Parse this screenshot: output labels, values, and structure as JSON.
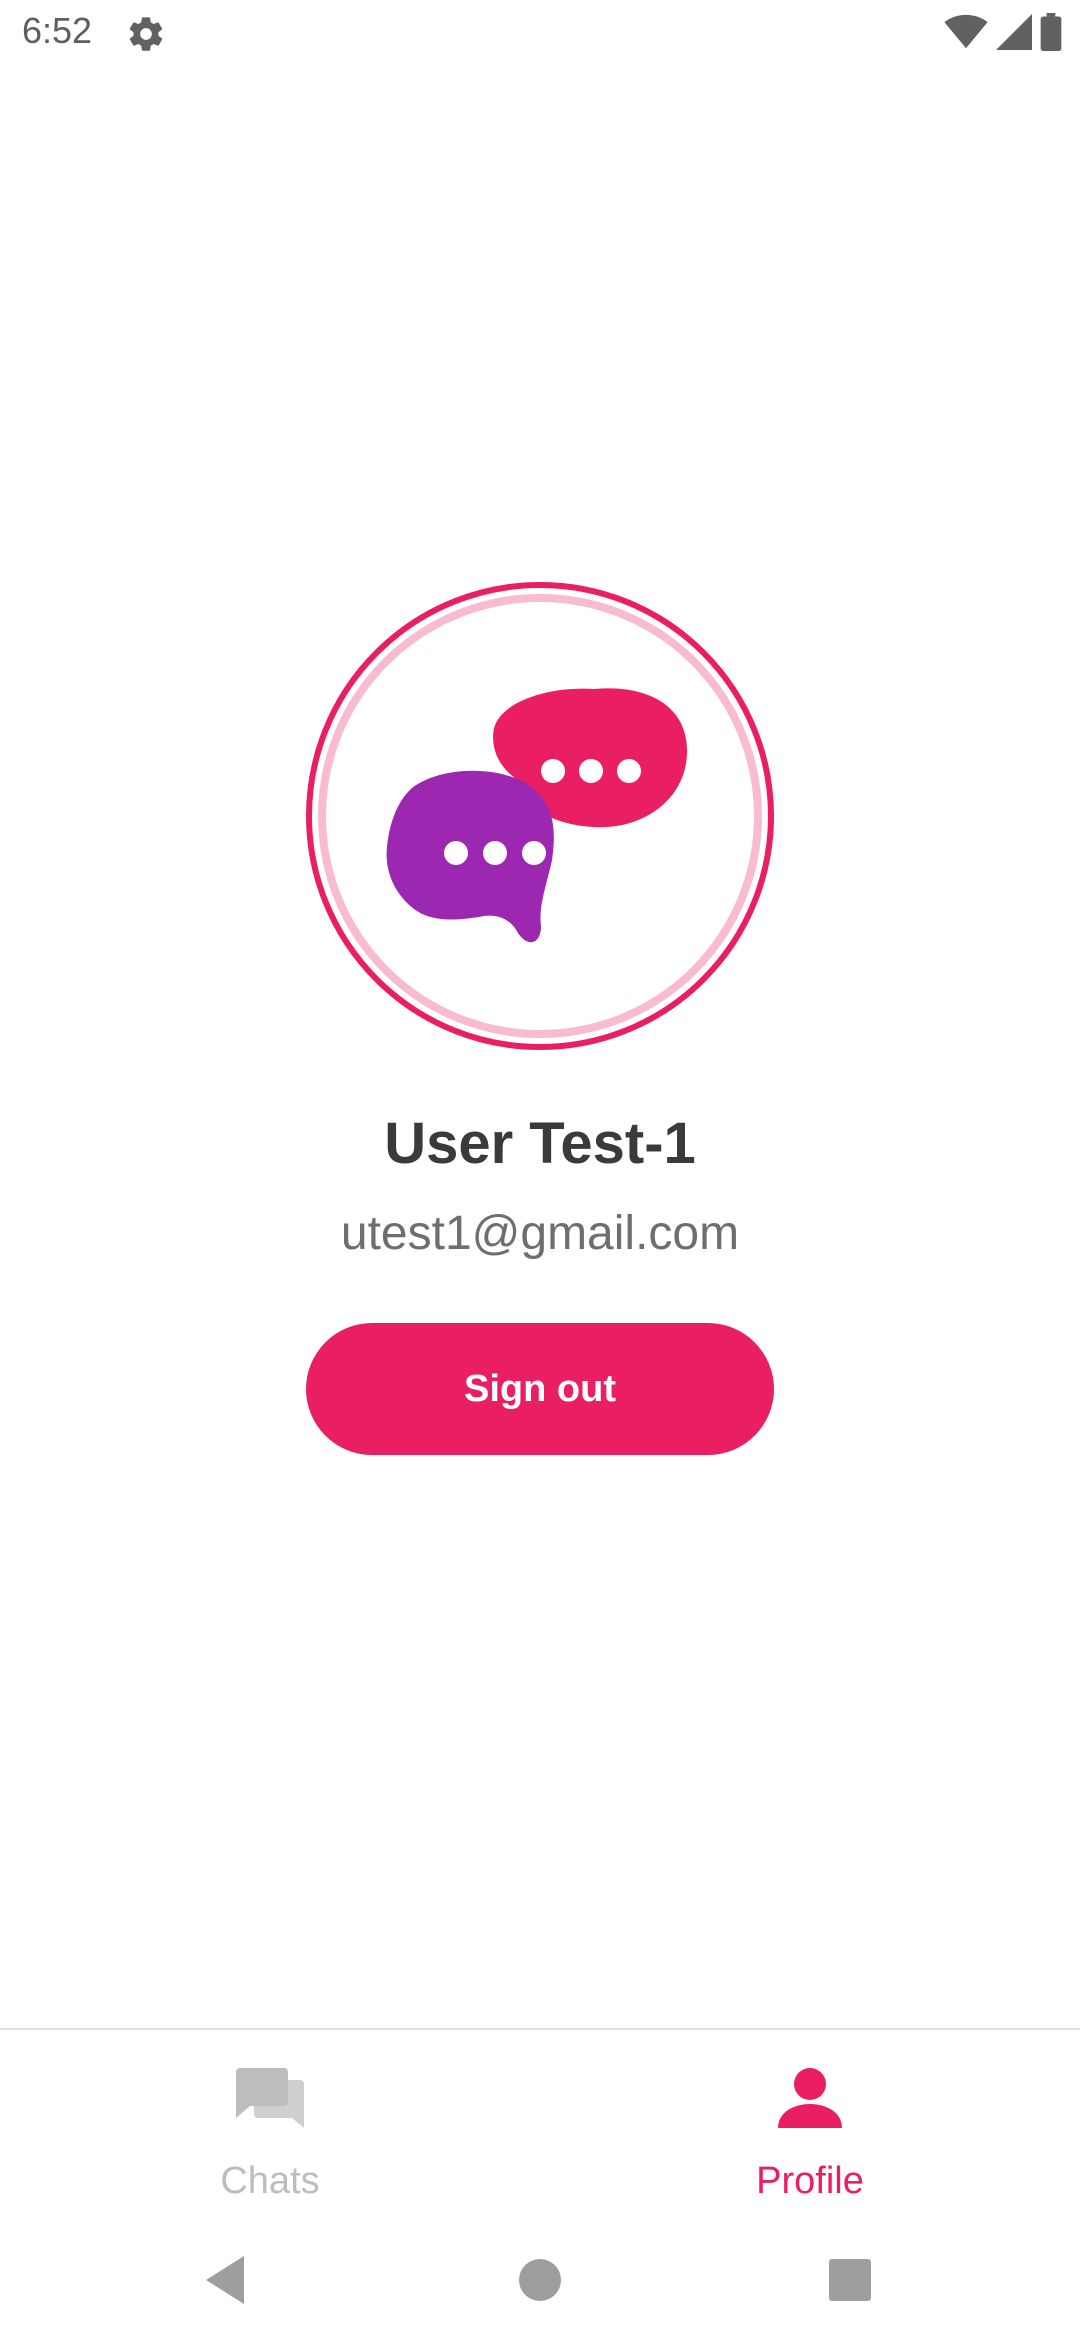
{
  "status_bar": {
    "time": "6:52",
    "icons": [
      "gear-icon",
      "wifi-icon",
      "cell-signal-icon",
      "battery-icon"
    ]
  },
  "profile": {
    "name": "User Test-1",
    "email": "utest1@gmail.com",
    "avatar_icon": "chat-bubbles-logo"
  },
  "actions": {
    "sign_out_label": "Sign out"
  },
  "bottom_nav": {
    "items": [
      {
        "label": "Chats",
        "icon": "chats-icon",
        "active": false
      },
      {
        "label": "Profile",
        "icon": "person-icon",
        "active": true
      }
    ]
  },
  "system_nav": {
    "buttons": [
      "back-icon",
      "home-icon",
      "recents-icon"
    ]
  },
  "colors": {
    "accent": "#e91e63",
    "accent_light": "#f8bbd0",
    "purple": "#9c27b0",
    "inactive": "#bdbdbd",
    "text_dark": "#3a3a3a",
    "text_gray": "#6e6e6e"
  }
}
